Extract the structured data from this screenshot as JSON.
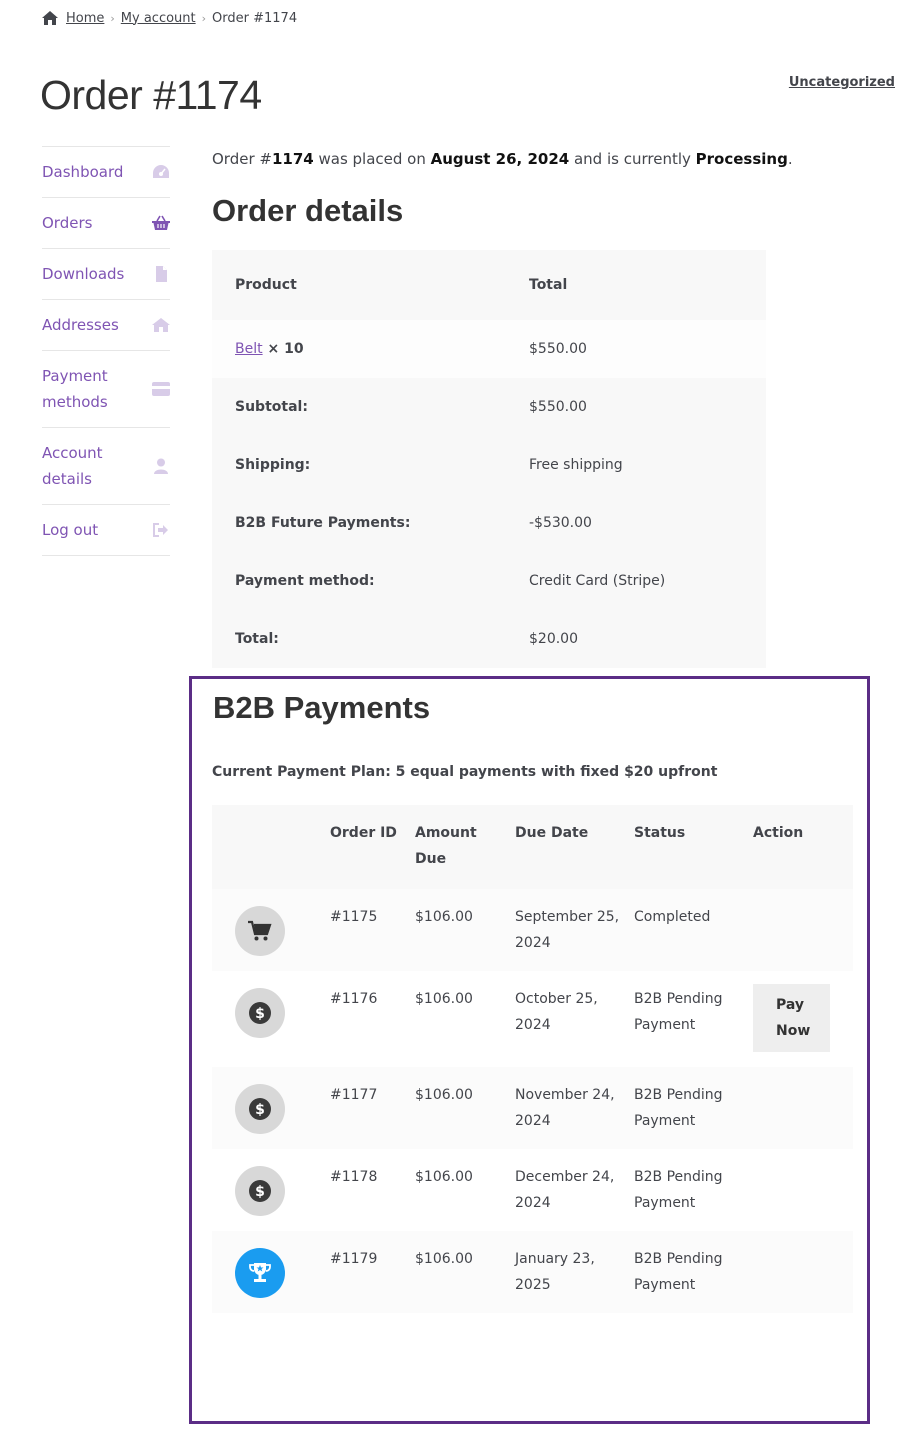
{
  "breadcrumb": {
    "home": "Home",
    "account": "My account",
    "current": "Order #1174",
    "sep": "›"
  },
  "page": {
    "title": "Order #1174",
    "top_link": "Uncategorized"
  },
  "sidebar": {
    "items": [
      {
        "label": "Dashboard",
        "icon": "dashboard-icon"
      },
      {
        "label": "Orders",
        "icon": "basket-icon"
      },
      {
        "label": "Downloads",
        "icon": "file-icon"
      },
      {
        "label": "Addresses",
        "icon": "home-icon"
      },
      {
        "label": "Payment methods",
        "icon": "card-icon"
      },
      {
        "label": "Account details",
        "icon": "user-icon"
      },
      {
        "label": "Log out",
        "icon": "logout-icon"
      }
    ]
  },
  "intro": {
    "p1": "Order #",
    "order_no": "1174",
    "p2": " was placed on ",
    "date": "August 26, 2024",
    "p3": " and is currently ",
    "status": "Processing",
    "p4": "."
  },
  "order_details": {
    "title": "Order details",
    "headers": {
      "product": "Product",
      "total": "Total"
    },
    "item": {
      "name": "Belt",
      "qty": " × 10",
      "total": "$550.00"
    },
    "totals": [
      {
        "label": "Subtotal:",
        "value": "$550.00"
      },
      {
        "label": "Shipping:",
        "value": "Free shipping"
      },
      {
        "label": "B2B Future Payments:",
        "value": "-$530.00"
      },
      {
        "label": "Payment method:",
        "value": "Credit Card (Stripe)"
      },
      {
        "label": "Total:",
        "value": "$20.00"
      }
    ]
  },
  "b2b": {
    "title": "B2B Payments",
    "plan": "Current Payment Plan: 5 equal payments with fixed $20 upfront",
    "headers": {
      "order_id": "Order ID",
      "amount": "Amount Due",
      "due": "Due Date",
      "status": "Status",
      "action": "Action"
    },
    "rows": [
      {
        "icon": "cart-icon",
        "id": "#1175",
        "amount": "$106.00",
        "due": "September 25, 2024",
        "status": "Completed",
        "action": ""
      },
      {
        "icon": "dollar-icon",
        "id": "#1176",
        "amount": "$106.00",
        "due": "October 25, 2024",
        "status": "B2B Pending Payment",
        "action": "Pay Now"
      },
      {
        "icon": "dollar-icon",
        "id": "#1177",
        "amount": "$106.00",
        "due": "November 24, 2024",
        "status": "B2B Pending Payment",
        "action": ""
      },
      {
        "icon": "dollar-icon",
        "id": "#1178",
        "amount": "$106.00",
        "due": "December 24, 2024",
        "status": "B2B Pending Payment",
        "action": ""
      },
      {
        "icon": "trophy-icon",
        "id": "#1179",
        "amount": "$106.00",
        "due": "January 23, 2025",
        "status": "B2B Pending Payment",
        "action": ""
      }
    ]
  },
  "colors": {
    "accent": "#7f54b3",
    "box_border": "#5b2d86",
    "final_icon": "#1a9cf0"
  }
}
